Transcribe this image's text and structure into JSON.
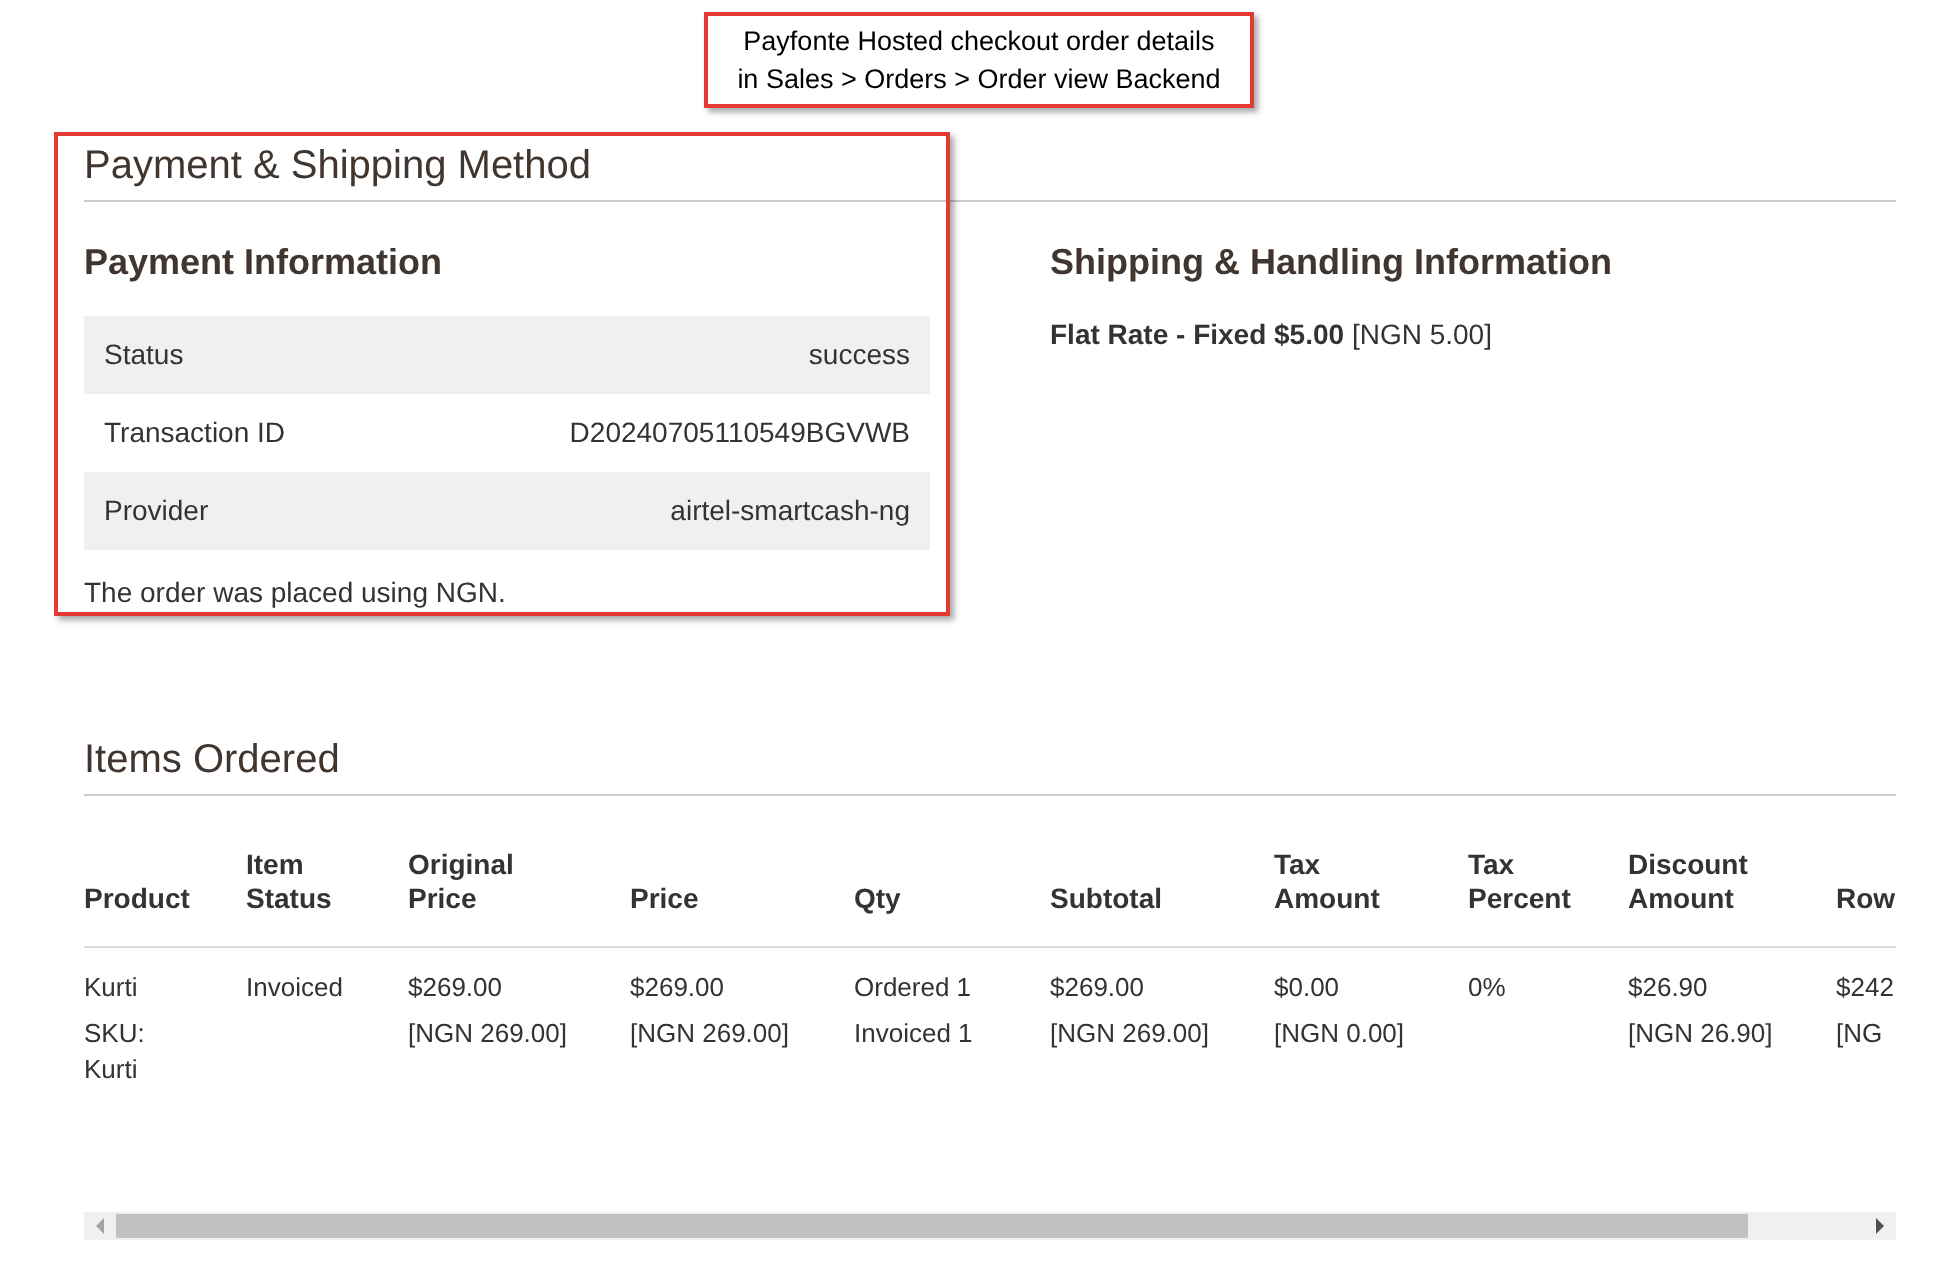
{
  "annotation": {
    "lines": [
      "Payfonte Hosted checkout order details",
      "in Sales > Orders > Order view Backend"
    ]
  },
  "payment_shipping": {
    "title": "Payment & Shipping Method",
    "payment": {
      "title": "Payment Information",
      "rows": [
        {
          "label": "Status",
          "value": "success"
        },
        {
          "label": "Transaction ID",
          "value": "D20240705110549BGVWB"
        },
        {
          "label": "Provider",
          "value": "airtel-smartcash-ng"
        }
      ],
      "note": "The order was placed using NGN."
    },
    "shipping": {
      "title": "Shipping & Handling Information",
      "method": "Flat Rate - Fixed $5.00",
      "amount": "[NGN 5.00]"
    }
  },
  "items_ordered": {
    "title": "Items Ordered",
    "columns": [
      "Product",
      "Item\nStatus",
      "Original\nPrice",
      "Price",
      "Qty",
      "Subtotal",
      "Tax\nAmount",
      "Tax\nPercent",
      "Discount\nAmount",
      "Row"
    ],
    "rows": [
      {
        "cells": [
          [
            "Kurti",
            "SKU:\nKurti"
          ],
          [
            "Invoiced"
          ],
          [
            "$269.00",
            "[NGN 269.00]"
          ],
          [
            "$269.00",
            "[NGN 269.00]"
          ],
          [
            "Ordered 1",
            "Invoiced 1"
          ],
          [
            "$269.00",
            "[NGN 269.00]"
          ],
          [
            "$0.00",
            "[NGN 0.00]"
          ],
          [
            "0%"
          ],
          [
            "$26.90",
            "[NGN 26.90]"
          ],
          [
            "$242",
            "[NG"
          ]
        ]
      }
    ]
  }
}
